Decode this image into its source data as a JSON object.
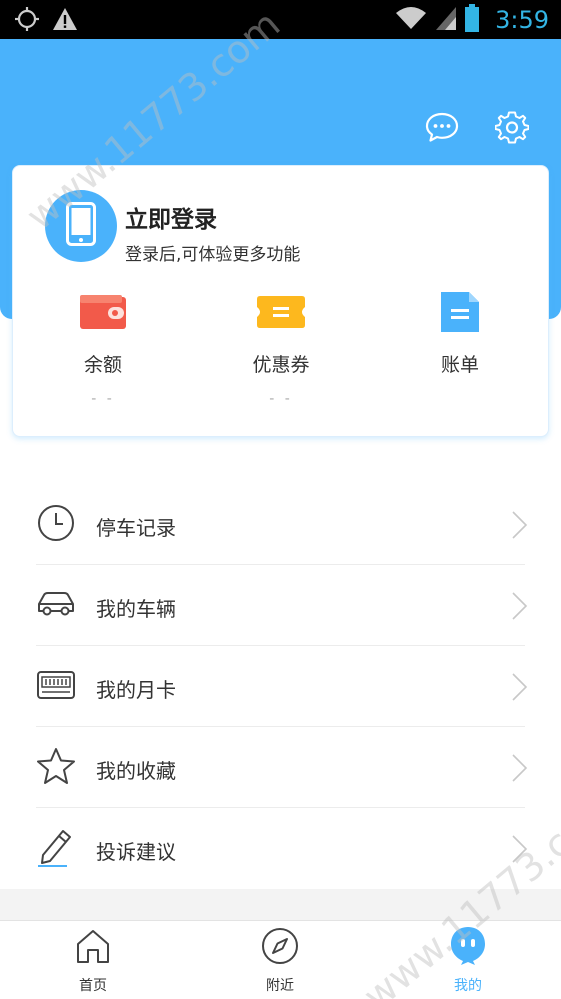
{
  "status_bar": {
    "time": "3:59",
    "icons": [
      "location-crosshair-icon",
      "warning-icon",
      "wifi-icon",
      "signal-icon",
      "battery-icon"
    ]
  },
  "header": {
    "icons": [
      "message-icon",
      "settings-icon"
    ],
    "bg_color": "#4ab2fb"
  },
  "login_card": {
    "title": "立即登录",
    "subtitle": "登录后,可体验更多功能",
    "avatar_icon": "phone-icon",
    "stats": [
      {
        "label": "余额",
        "value": "- -",
        "icon": "wallet-icon",
        "color": "#f25a4a"
      },
      {
        "label": "优惠券",
        "value": "- -",
        "icon": "coupon-icon",
        "color": "#fdb81e"
      },
      {
        "label": "账单",
        "value": "",
        "icon": "bill-icon",
        "color": "#4ab2fb"
      }
    ]
  },
  "menu": {
    "items": [
      {
        "label": "停车记录",
        "icon": "clock-icon"
      },
      {
        "label": "我的车辆",
        "icon": "car-icon"
      },
      {
        "label": "我的月卡",
        "icon": "card-icon"
      },
      {
        "label": "我的收藏",
        "icon": "star-icon"
      },
      {
        "label": "投诉建议",
        "icon": "pencil-icon"
      }
    ]
  },
  "tabbar": {
    "tabs": [
      {
        "label": "首页",
        "icon": "home-icon",
        "active": false
      },
      {
        "label": "附近",
        "icon": "compass-icon",
        "active": false
      },
      {
        "label": "我的",
        "icon": "profile-icon",
        "active": true
      }
    ]
  },
  "watermark": {
    "text": "www.11773.com"
  }
}
